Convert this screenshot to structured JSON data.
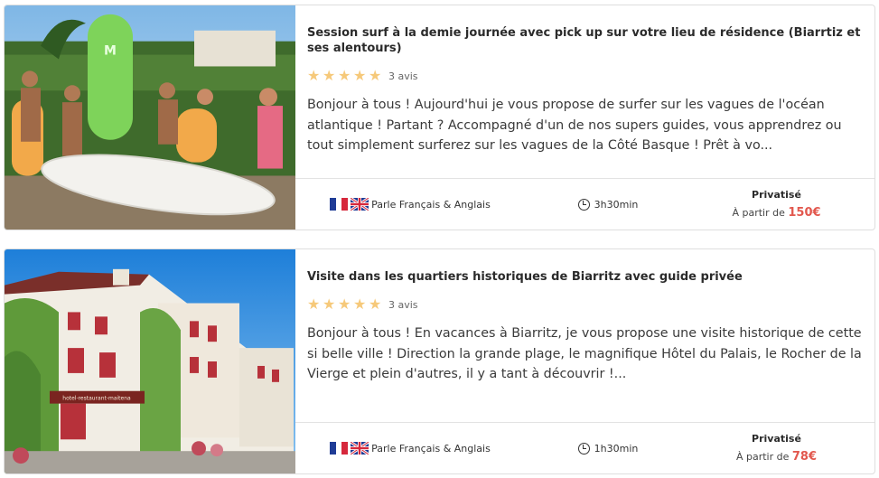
{
  "cards": [
    {
      "title": "Session surf à la demie journée avec pick up sur votre lieu de résidence (Biarrtiz et ses alentours)",
      "rating": 5,
      "reviews": "3 avis",
      "description": "Bonjour à tous ! Aujourd'hui je vous propose de surfer sur les vagues de l'océan atlantique ! Partant ? Accompagné d'un de nos supers guides, vous apprendrez ou tout simplement surferez sur les vagues de la Côté Basque ! Prêt à vo...",
      "languages": "Parle Français & Anglais",
      "duration": "3h30min",
      "type": "Privatisé",
      "price_prefix": "À partir de",
      "price": "150€",
      "image": "surf-group-photo"
    },
    {
      "title": "Visite dans les quartiers historiques de Biarritz avec guide privée",
      "rating": 5,
      "reviews": "3 avis",
      "description": "Bonjour à tous ! En vacances à Biarritz, je vous propose une visite historique de cette si belle ville ! Direction la grande plage, le magnifique Hôtel du Palais, le Rocher de la Vierge et plein d'autres, il y a tant à découvrir !...",
      "languages": "Parle Français & Anglais",
      "duration": "1h30min",
      "type": "Privatisé",
      "price_prefix": "À partir de",
      "price": "78€",
      "image": "basque-buildings-photo",
      "building_sign": "hotel-restaurant-maitena"
    }
  ],
  "colors": {
    "price": "#e2584e",
    "star": "#f6c97a",
    "border": "#dedede"
  },
  "icons": [
    "star-icon",
    "flag-fr-icon",
    "flag-uk-icon",
    "clock-icon"
  ]
}
